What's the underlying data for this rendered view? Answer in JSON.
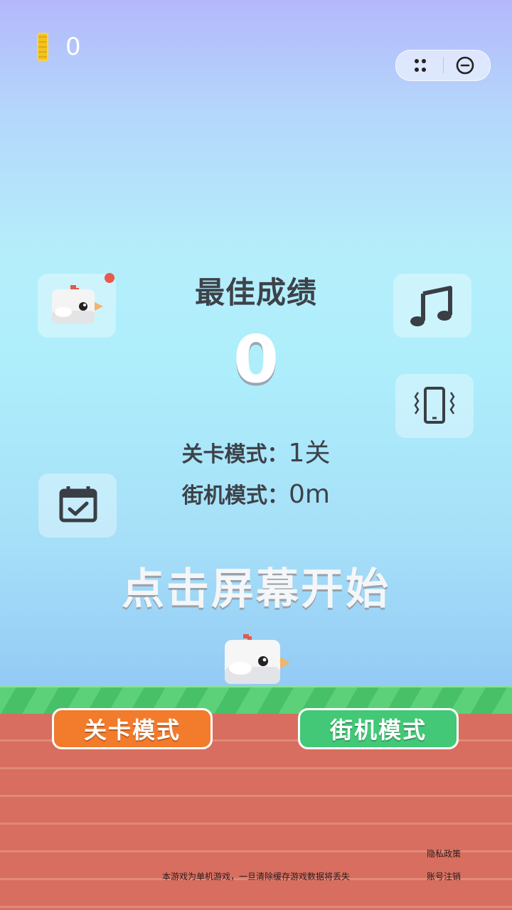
{
  "hud": {
    "coins": "0",
    "coin_icon": "coin-stack-icon",
    "capsule_more_icon": "more-dots-icon",
    "capsule_close_icon": "minimize-circle-icon"
  },
  "side_buttons": {
    "skin_icon": "chicken-icon",
    "music_icon": "music-note-icon",
    "vibrate_icon": "vibrate-phone-icon",
    "checkin_icon": "calendar-check-icon",
    "badge_color": "#e85a4a"
  },
  "scores": {
    "best_label": "最佳成绩",
    "best_value": "0",
    "level_mode_label": "关卡模式：",
    "level_mode_value": "1关",
    "arcade_mode_label": "街机模式：",
    "arcade_mode_value": "0m"
  },
  "start_hint": "点击屏幕开始",
  "buttons": {
    "level_mode": "关卡模式",
    "arcade_mode": "街机模式"
  },
  "footer": {
    "privacy": "隐私政策",
    "account": "账号注销",
    "note": "本游戏为单机游戏，一旦清除缓存游戏数据将丢失"
  },
  "colors": {
    "level_button": "#f27b2c",
    "arcade_button": "#42c876",
    "grass": "#5cd17a",
    "ground": "#d86e5f"
  }
}
